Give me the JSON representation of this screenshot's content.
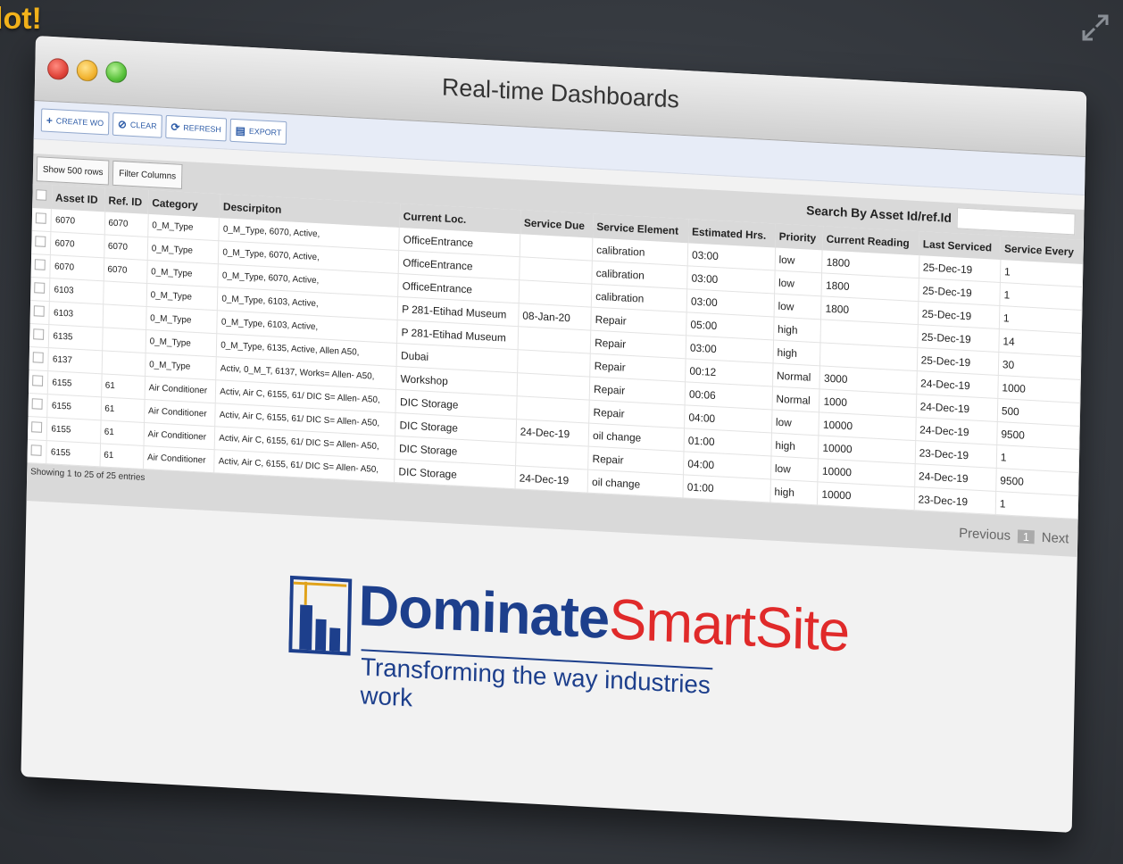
{
  "corner_text": "lot!",
  "window": {
    "title": "Real-time Dashboards"
  },
  "toolbar": {
    "create": "CREATE WO",
    "clear": "CLEAR",
    "refresh": "REFRESH",
    "export": "EXPORT"
  },
  "controls": {
    "show_rows": "Show 500 rows",
    "filter_columns": "Filter Columns",
    "search_label": "Search By Asset Id/ref.Id",
    "search_value": ""
  },
  "columns": [
    "Asset ID",
    "Ref. ID",
    "Category",
    "Descirpiton",
    "Current Loc.",
    "Service Due",
    "Service Element",
    "Estimated Hrs.",
    "Priority",
    "Current Reading",
    "Last Serviced",
    "Service Every"
  ],
  "rows": [
    [
      "6070",
      "6070",
      "0_M_Type",
      "0_M_Type, 6070, Active,",
      "OfficeEntrance",
      "",
      "calibration",
      "03:00",
      "low",
      "1800",
      "25-Dec-19",
      "1"
    ],
    [
      "6070",
      "6070",
      "0_M_Type",
      "0_M_Type, 6070, Active,",
      "OfficeEntrance",
      "",
      "calibration",
      "03:00",
      "low",
      "1800",
      "25-Dec-19",
      "1"
    ],
    [
      "6070",
      "6070",
      "0_M_Type",
      "0_M_Type, 6070, Active,",
      "OfficeEntrance",
      "",
      "calibration",
      "03:00",
      "low",
      "1800",
      "25-Dec-19",
      "1"
    ],
    [
      "6103",
      "",
      "0_M_Type",
      "0_M_Type, 6103, Active,",
      "P 281-Etihad Museum",
      "08-Jan-20",
      "Repair",
      "05:00",
      "high",
      "",
      "25-Dec-19",
      "14"
    ],
    [
      "6103",
      "",
      "0_M_Type",
      "0_M_Type, 6103, Active,",
      "P 281-Etihad Museum",
      "",
      "Repair",
      "03:00",
      "high",
      "",
      "25-Dec-19",
      "30"
    ],
    [
      "6135",
      "",
      "0_M_Type",
      "0_M_Type, 6135, Active, Allen A50,",
      "Dubai",
      "",
      "Repair",
      "00:12",
      "Normal",
      "3000",
      "24-Dec-19",
      "1000"
    ],
    [
      "6137",
      "",
      "0_M_Type",
      "Activ, 0_M_T, 6137, Works= Allen- A50,",
      "Workshop",
      "",
      "Repair",
      "00:06",
      "Normal",
      "1000",
      "24-Dec-19",
      "500"
    ],
    [
      "6155",
      "61",
      "Air Conditioner",
      "Activ, Air C, 6155, 61/ DIC S= Allen- A50,",
      "DIC Storage",
      "",
      "Repair",
      "04:00",
      "low",
      "10000",
      "24-Dec-19",
      "9500"
    ],
    [
      "6155",
      "61",
      "Air Conditioner",
      "Activ, Air C, 6155, 61/ DIC S= Allen- A50,",
      "DIC Storage",
      "24-Dec-19",
      "oil change",
      "01:00",
      "high",
      "10000",
      "23-Dec-19",
      "1"
    ],
    [
      "6155",
      "61",
      "Air Conditioner",
      "Activ, Air C, 6155, 61/ DIC S= Allen- A50,",
      "DIC Storage",
      "",
      "Repair",
      "04:00",
      "low",
      "10000",
      "24-Dec-19",
      "9500"
    ],
    [
      "6155",
      "61",
      "Air Conditioner",
      "Activ, Air C, 6155, 61/ DIC S= Allen- A50,",
      "DIC Storage",
      "24-Dec-19",
      "oil change",
      "01:00",
      "high",
      "10000",
      "23-Dec-19",
      "1"
    ]
  ],
  "footer": {
    "info": "Showing 1 to 25 of 25 entries",
    "previous": "Previous",
    "page": "1",
    "next": "Next"
  },
  "logo": {
    "word_a": "Dominate",
    "word_b": "SmartSite",
    "tagline": "Transforming the way industries work"
  },
  "colors": {
    "accent": "#f2b21b",
    "brand_blue": "#1d3f8c",
    "brand_red": "#e02a2a"
  }
}
